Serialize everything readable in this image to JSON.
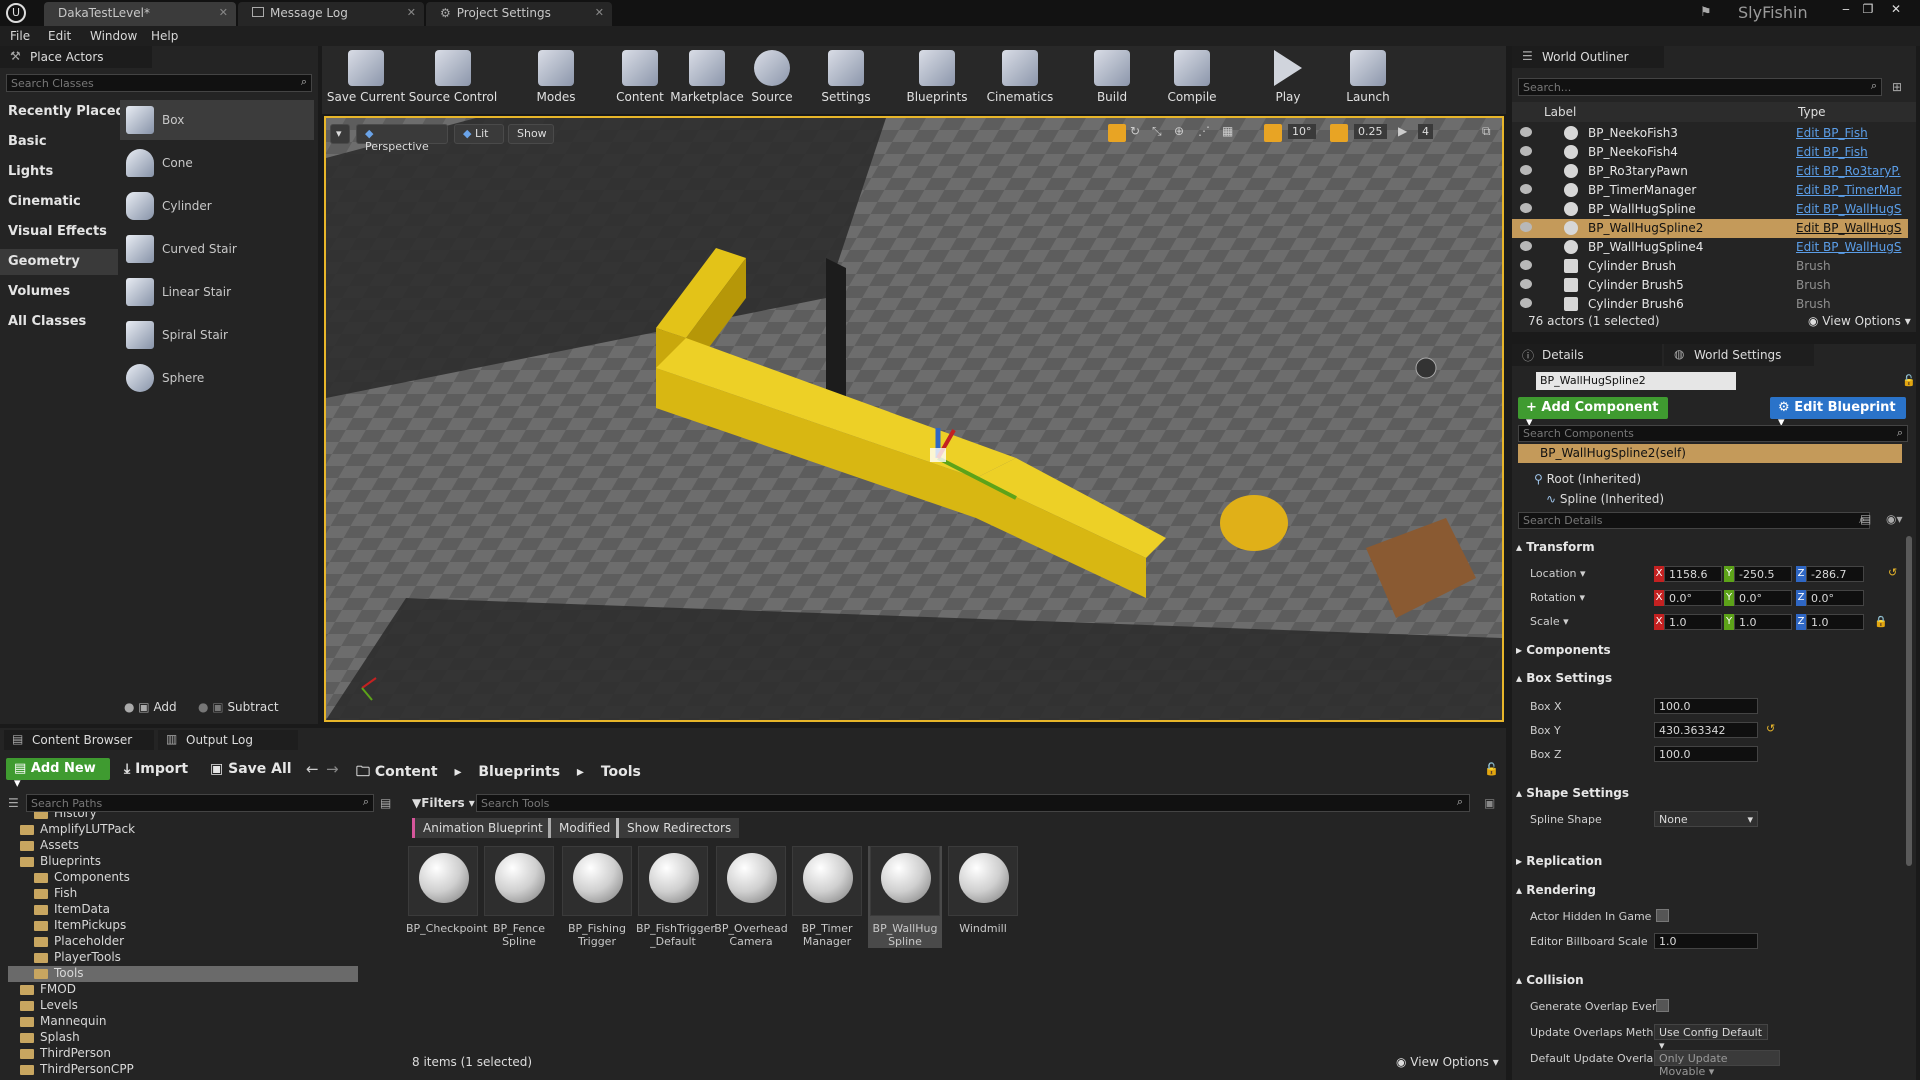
{
  "titlebar": {
    "tabs": [
      {
        "label": "DakaTestLevel*"
      },
      {
        "label": "Message Log"
      },
      {
        "label": "Project Settings"
      }
    ],
    "user": "SlyFishin"
  },
  "menu": [
    "File",
    "Edit",
    "Window",
    "Help"
  ],
  "place_actors": {
    "title": "Place Actors",
    "search_placeholder": "Search Classes",
    "categories": [
      "Recently Placed",
      "Basic",
      "Lights",
      "Cinematic",
      "Visual Effects",
      "Geometry",
      "Volumes",
      "All Classes"
    ],
    "selected_category": "Geometry",
    "shapes": [
      "Box",
      "Cone",
      "Cylinder",
      "Curved Stair",
      "Linear Stair",
      "Spiral Stair",
      "Sphere"
    ],
    "add_label": "Add",
    "subtract_label": "Subtract"
  },
  "toolbar": [
    "Save Current",
    "Source Control",
    "Modes",
    "Content",
    "Marketplace",
    "Source",
    "Settings",
    "Blueprints",
    "Cinematics",
    "Build",
    "Compile",
    "Play",
    "Launch"
  ],
  "viewport": {
    "perspective": "Perspective",
    "lit": "Lit",
    "show": "Show",
    "angle_snap": "10°",
    "scale_snap": "0.25",
    "camera_speed": "4"
  },
  "outliner": {
    "title": "World Outliner",
    "search_placeholder": "Search...",
    "col_label": "Label",
    "col_type": "Type",
    "rows": [
      {
        "label": "BP_NeekoFish3",
        "type": "Edit BP_Fish",
        "link": true
      },
      {
        "label": "BP_NeekoFish4",
        "type": "Edit BP_Fish",
        "link": true
      },
      {
        "label": "BP_Ro3taryPawn",
        "type": "Edit BP_Ro3taryP.",
        "link": true
      },
      {
        "label": "BP_TimerManager",
        "type": "Edit BP_TimerMar",
        "link": true
      },
      {
        "label": "BP_WallHugSpline",
        "type": "Edit BP_WallHugS",
        "link": true
      },
      {
        "label": "BP_WallHugSpline2",
        "type": "Edit BP_WallHugS",
        "link": true,
        "selected": true
      },
      {
        "label": "BP_WallHugSpline4",
        "type": "Edit BP_WallHugS",
        "link": true
      },
      {
        "label": "Cylinder Brush",
        "type": "Brush",
        "link": false
      },
      {
        "label": "Cylinder Brush5",
        "type": "Brush",
        "link": false
      },
      {
        "label": "Cylinder Brush6",
        "type": "Brush",
        "link": false
      }
    ],
    "footer": "76 actors (1 selected)",
    "view_options": "View Options"
  },
  "details": {
    "tab_details": "Details",
    "tab_world": "World Settings",
    "actor_name": "BP_WallHugSpline2",
    "add_component": "+ Add Component",
    "edit_blueprint": "Edit Blueprint",
    "search_components": "Search Components",
    "self_row": "BP_WallHugSpline2(self)",
    "root_row": "Root (Inherited)",
    "spline_row": "Spline (Inherited)",
    "search_details": "Search Details",
    "transform": "Transform",
    "location_label": "Location",
    "rotation_label": "Rotation",
    "scale_label": "Scale",
    "location": [
      "1158.6",
      "-250.5",
      "-286.7"
    ],
    "rotation": [
      "0.0°",
      "0.0°",
      "0.0°"
    ],
    "scale": [
      "1.0",
      "1.0",
      "1.0"
    ],
    "components": "Components",
    "box_settings": "Box Settings",
    "box_x_label": "Box X",
    "box_y_label": "Box Y",
    "box_z_label": "Box Z",
    "box_x": "100.0",
    "box_y": "430.363342",
    "box_z": "100.0",
    "shape_settings": "Shape Settings",
    "spline_shape_label": "Spline Shape",
    "spline_shape": "None",
    "replication": "Replication",
    "rendering": "Rendering",
    "hidden_label": "Actor Hidden In Game",
    "billboard_label": "Editor Billboard Scale",
    "billboard_value": "1.0",
    "collision": "Collision",
    "overlap_label": "Generate Overlap Events",
    "update_method_label": "Update Overlaps Method",
    "update_method": "Use Config Default",
    "default_update_label": "Default Update Overlaps",
    "default_update": "Only Update Movable"
  },
  "content_browser": {
    "tab_browser": "Content Browser",
    "tab_log": "Output Log",
    "add_new": "Add New",
    "import": "Import",
    "save_all": "Save All",
    "path": [
      "Content",
      "Blueprints",
      "Tools"
    ],
    "search_paths": "Search Paths",
    "filters": "Filters",
    "search_tools": "Search Tools",
    "filter_chips": [
      "Animation Blueprint",
      "Modified",
      "Show Redirectors"
    ],
    "tree": [
      {
        "label": "History",
        "depth": 1
      },
      {
        "label": "AmplifyLUTPack",
        "depth": 0
      },
      {
        "label": "Assets",
        "depth": 0
      },
      {
        "label": "Blueprints",
        "depth": 0
      },
      {
        "label": "Components",
        "depth": 1
      },
      {
        "label": "Fish",
        "depth": 1
      },
      {
        "label": "ItemData",
        "depth": 1
      },
      {
        "label": "ItemPickups",
        "depth": 1
      },
      {
        "label": "Placeholder",
        "depth": 1
      },
      {
        "label": "PlayerTools",
        "depth": 1
      },
      {
        "label": "Tools",
        "depth": 1,
        "selected": true
      },
      {
        "label": "FMOD",
        "depth": 0
      },
      {
        "label": "Levels",
        "depth": 0
      },
      {
        "label": "Mannequin",
        "depth": 0
      },
      {
        "label": "Splash",
        "depth": 0
      },
      {
        "label": "ThirdPerson",
        "depth": 0
      },
      {
        "label": "ThirdPersonCPP",
        "depth": 0
      }
    ],
    "assets": [
      {
        "line1": "BP_Checkpoint",
        "line2": ""
      },
      {
        "line1": "BP_Fence",
        "line2": "Spline"
      },
      {
        "line1": "BP_Fishing",
        "line2": "Trigger"
      },
      {
        "line1": "BP_FishTrigger",
        "line2": "_Default"
      },
      {
        "line1": "BP_Overhead",
        "line2": "Camera"
      },
      {
        "line1": "BP_Timer",
        "line2": "Manager"
      },
      {
        "line1": "BP_WallHug",
        "line2": "Spline",
        "selected": true
      },
      {
        "line1": "Windmill",
        "line2": ""
      }
    ],
    "footer": "8 items (1 selected)",
    "view_options": "View Options"
  },
  "colors": {
    "accent_green": "#3f9b30",
    "accent_blue": "#2a73c9",
    "selection": "#c49a5a",
    "viewport_border": "#e8b62a"
  }
}
